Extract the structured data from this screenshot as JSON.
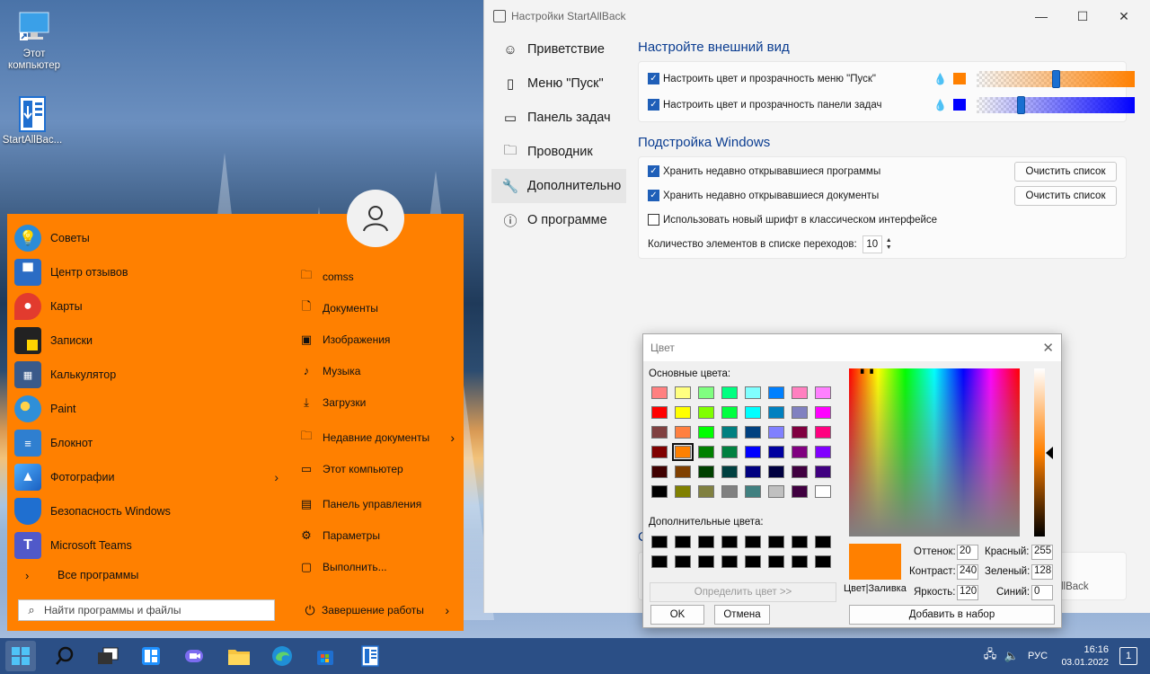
{
  "desktop": {
    "icons": [
      {
        "label": "Этот компьютер",
        "icon": "computer-icon"
      },
      {
        "label": "StartAllBac...",
        "icon": "installer-icon"
      }
    ]
  },
  "start_menu": {
    "accent_color": "#ff8000",
    "apps": [
      {
        "label": "Советы",
        "icon": "tips-icon",
        "color": "#1e90ff"
      },
      {
        "label": "Центр отзывов",
        "icon": "feedback-icon",
        "color": "#2b6cc4"
      },
      {
        "label": "Карты",
        "icon": "maps-icon",
        "color": "#e23b2e"
      },
      {
        "label": "Записки",
        "icon": "sticky-notes-icon",
        "color": "#222222"
      },
      {
        "label": "Калькулятор",
        "icon": "calculator-icon",
        "color": "#3a5a8a"
      },
      {
        "label": "Paint",
        "icon": "paint-icon",
        "color": "#2f8fd8"
      },
      {
        "label": "Блокнот",
        "icon": "notepad-icon",
        "color": "#2f7fd0"
      },
      {
        "label": "Фотографии",
        "icon": "photos-icon",
        "color": "#2a7ad0",
        "has_arrow": true
      },
      {
        "label": "Безопасность Windows",
        "icon": "shield-icon",
        "color": "#1f6fd0"
      },
      {
        "label": "Microsoft Teams",
        "icon": "teams-icon",
        "color": "#5059c9"
      }
    ],
    "all_programs": "Все программы",
    "search_placeholder": "Найти программы и файлы",
    "places": [
      {
        "label": "comss",
        "icon": "user-folder-icon"
      },
      {
        "label": "Документы",
        "icon": "documents-icon"
      },
      {
        "label": "Изображения",
        "icon": "pictures-icon"
      },
      {
        "label": "Музыка",
        "icon": "music-icon"
      },
      {
        "label": "Загрузки",
        "icon": "downloads-icon"
      },
      {
        "label": "Недавние документы",
        "icon": "recent-docs-icon",
        "has_arrow": true
      },
      {
        "label": "Этот компьютер",
        "icon": "this-pc-icon"
      },
      {
        "label": "Панель управления",
        "icon": "control-panel-icon"
      },
      {
        "label": "Параметры",
        "icon": "settings-icon"
      },
      {
        "label": "Выполнить...",
        "icon": "run-icon"
      }
    ],
    "power_label": "Завершение работы"
  },
  "settings_window": {
    "title": "Настройки StartAllBack",
    "nav": [
      {
        "label": "Приветствие",
        "icon": "smile-icon"
      },
      {
        "label": "Меню \"Пуск\"",
        "icon": "start-menu-icon"
      },
      {
        "label": "Панель задач",
        "icon": "taskbar-icon"
      },
      {
        "label": "Проводник",
        "icon": "folder-icon"
      },
      {
        "label": "Дополнительно",
        "icon": "wrench-icon",
        "active": true
      },
      {
        "label": "О программе",
        "icon": "about-icon"
      }
    ],
    "appearance": {
      "title": "Настройте внешний вид",
      "rows": [
        {
          "label": "Настроить цвет и прозрачность меню \"Пуск\"",
          "checked": true,
          "color": "#ff8000",
          "opacity": 0.5
        },
        {
          "label": "Настроить цвет и прозрачность панели задач",
          "checked": true,
          "color": "#0000ff",
          "opacity": 0.28
        }
      ]
    },
    "tweaks": {
      "title": "Подстройка Windows",
      "rows": [
        {
          "label": "Хранить недавно открывавшиеся программы",
          "checked": true,
          "button": "Очистить список"
        },
        {
          "label": "Хранить недавно открывавшиеся документы",
          "checked": true,
          "button": "Очистить список"
        },
        {
          "label": "Использовать новый шрифт в классическом интерфейсе",
          "checked": false
        }
      ],
      "jumplist_label": "Количество элементов в списке переходов:",
      "jumplist_value": "10"
    },
    "hidden_text_fragment": "llBack",
    "hidden_letter": "С"
  },
  "color_dialog": {
    "title": "Цвет",
    "basic_colors_label": "Основные цвета:",
    "custom_colors_label": "Дополнительные цвета:",
    "basic_colors": [
      "#ff8080",
      "#ffff80",
      "#80ff80",
      "#00ff80",
      "#80ffff",
      "#0080ff",
      "#ff80c0",
      "#ff80ff",
      "#ff0000",
      "#ffff00",
      "#80ff00",
      "#00ff40",
      "#00ffff",
      "#0080c0",
      "#8080c0",
      "#ff00ff",
      "#804040",
      "#ff8040",
      "#00ff00",
      "#008080",
      "#004080",
      "#8080ff",
      "#800040",
      "#ff0080",
      "#800000",
      "#ff8000",
      "#008000",
      "#008040",
      "#0000ff",
      "#0000a0",
      "#800080",
      "#8000ff",
      "#400000",
      "#804000",
      "#004000",
      "#004040",
      "#000080",
      "#000040",
      "#400040",
      "#400080",
      "#000000",
      "#808000",
      "#808040",
      "#808080",
      "#408080",
      "#c0c0c0",
      "#400040",
      "#ffffff"
    ],
    "selected_index": 25,
    "custom_colors": [
      "#000000",
      "#000000",
      "#000000",
      "#000000",
      "#000000",
      "#000000",
      "#000000",
      "#000000",
      "#000000",
      "#000000",
      "#000000",
      "#000000",
      "#000000",
      "#000000",
      "#000000",
      "#000000"
    ],
    "define_button": "Определить цвет >>",
    "ok_button": "OK",
    "cancel_button": "Отмена",
    "add_button": "Добавить в набор",
    "preview_label": "Цвет|Заливка",
    "hue_label": "Оттенок:",
    "hue": "20",
    "sat_label": "Контраст:",
    "sat": "240",
    "lum_label": "Яркость:",
    "lum": "120",
    "red_label": "Красный:",
    "red": "255",
    "green_label": "Зеленый:",
    "green": "128",
    "blue_label": "Синий:",
    "blue": "0",
    "current_color": "#ff8000"
  },
  "taskbar": {
    "color": "#2b4f86",
    "icons": [
      "start-icon",
      "search-icon",
      "task-view-icon",
      "widgets-icon",
      "chat-icon",
      "explorer-icon",
      "edge-icon",
      "store-icon",
      "startallback-icon"
    ],
    "language": "РУС",
    "time": "16:16",
    "date": "03.01.2022",
    "notification_count": "1"
  }
}
